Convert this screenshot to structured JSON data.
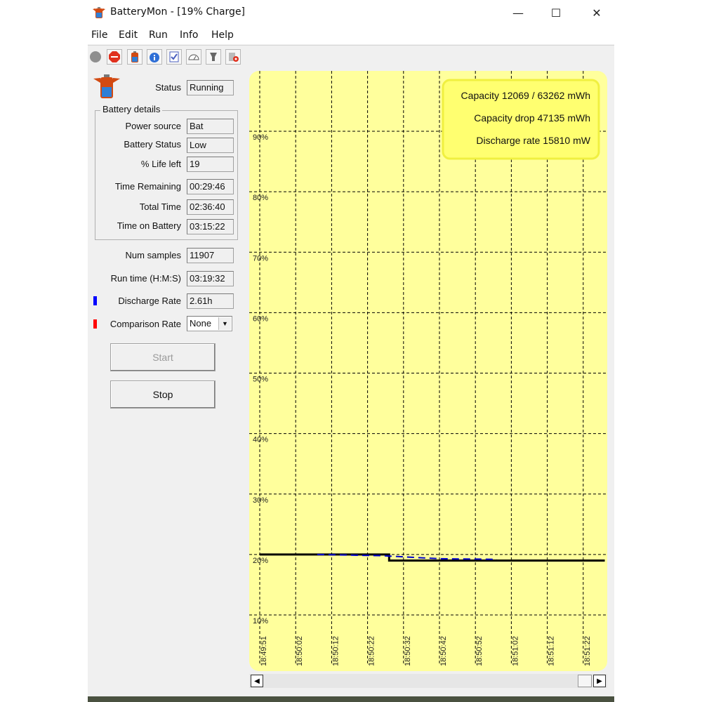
{
  "window": {
    "title": "BatteryMon - [19% Charge]",
    "controls": {
      "minimize": "—",
      "maximize": "☐",
      "close": "✕"
    }
  },
  "menu": [
    "File",
    "Edit",
    "Run",
    "Info",
    "Help"
  ],
  "toolbar": {
    "icons": [
      "record-icon",
      "stop-icon",
      "battery-icon",
      "info-icon",
      "checklist-icon",
      "gauge-icon",
      "pin-icon",
      "settings-icon"
    ]
  },
  "status": {
    "label": "Status",
    "value": "Running"
  },
  "battery_details": {
    "title": "Battery details",
    "rows": [
      {
        "label": "Power source",
        "value": "Bat"
      },
      {
        "label": "Battery Status",
        "value": "Low"
      },
      {
        "label": "% Life left",
        "value": "19"
      },
      {
        "label": "Time Remaining",
        "value": "00:29:46"
      },
      {
        "label": "Total Time",
        "value": "02:36:40"
      },
      {
        "label": "Time on Battery",
        "value": "03:15:22"
      }
    ]
  },
  "num_samples": {
    "label": "Num samples",
    "value": "11907"
  },
  "run_time": {
    "label": "Run time (H:M:S)",
    "value": "03:19:32"
  },
  "discharge_rate": {
    "label": "Discharge Rate",
    "value": "2.61h",
    "color": "#0000ff"
  },
  "comparison_rate": {
    "label": "Comparison Rate",
    "value": "None",
    "color": "#ff0000"
  },
  "buttons": {
    "start": "Start",
    "stop": "Stop"
  },
  "chart_data": {
    "type": "line",
    "background": "#ffff9c",
    "info": [
      "Capacity 12069 / 63262 mWh",
      "Capacity drop 47135 mWh",
      "Discharge rate 15810 mW"
    ],
    "y_tick_labels": [
      "90%",
      "80%",
      "70%",
      "60%",
      "50%",
      "40%",
      "30%",
      "20%",
      "10%"
    ],
    "y_ticks": [
      90,
      80,
      70,
      60,
      50,
      40,
      30,
      20,
      10
    ],
    "x_tick_labels": [
      "18:49:51",
      "18:50:02",
      "18:50:12",
      "18:50:22",
      "18:50:32",
      "18:50:42",
      "18:50:52",
      "18:51:02",
      "18:51:12",
      "18:51:22"
    ],
    "ylim": [
      5,
      100
    ],
    "grid": true,
    "series": [
      {
        "color": "#000000",
        "style": "solid",
        "points": [
          [
            0,
            20
          ],
          [
            3.6,
            20
          ],
          [
            3.6,
            19
          ],
          [
            9.6,
            19
          ]
        ]
      },
      {
        "color": "#0000cc",
        "style": "dashed",
        "points": [
          [
            1.6,
            20
          ],
          [
            3.4,
            19.8
          ],
          [
            5.0,
            19.3
          ],
          [
            6.6,
            19.2
          ]
        ]
      }
    ]
  }
}
